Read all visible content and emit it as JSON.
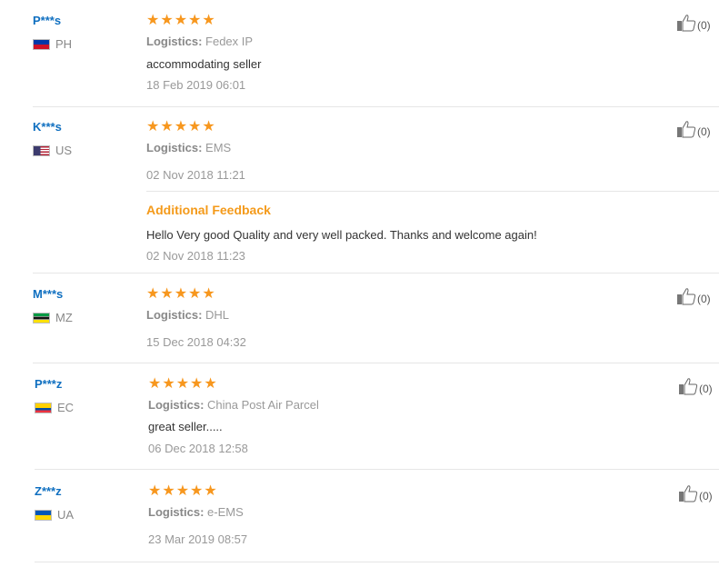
{
  "labels": {
    "logistics": "Logistics:",
    "additional_feedback": "Additional Feedback"
  },
  "colors": {
    "user_name": "#0f6fc0",
    "star": "#f7971e",
    "additional_feedback": "#f49a1a",
    "separator": "#e6e6e6"
  },
  "reviews": [
    {
      "user": "P***s",
      "country": "PH",
      "rating": 5,
      "logistics": "Fedex IP",
      "text": "accommodating seller",
      "date": "18 Feb 2019 06:01",
      "helpful_count": "(0)"
    },
    {
      "user": "K***s",
      "country": "US",
      "rating": 5,
      "logistics": "EMS",
      "text": "",
      "date": "02 Nov 2018 11:21",
      "additional_feedback": {
        "text": "Hello Very good Quality and very well packed. Thanks and welcome again!",
        "date": "02 Nov 2018 11:23"
      },
      "helpful_count": "(0)"
    },
    {
      "user": "M***s",
      "country": "MZ",
      "rating": 5,
      "logistics": "DHL",
      "text": "",
      "date": "15 Dec 2018 04:32",
      "helpful_count": "(0)"
    },
    {
      "user": "P***z",
      "country": "EC",
      "rating": 5,
      "logistics": "China Post Air Parcel",
      "text": "great seller.....",
      "date": "06 Dec 2018 12:58",
      "helpful_count": "(0)"
    },
    {
      "user": "Z***z",
      "country": "UA",
      "rating": 5,
      "logistics": "e-EMS",
      "text": "",
      "date": "23 Mar 2019 08:57",
      "helpful_count": "(0)"
    }
  ]
}
